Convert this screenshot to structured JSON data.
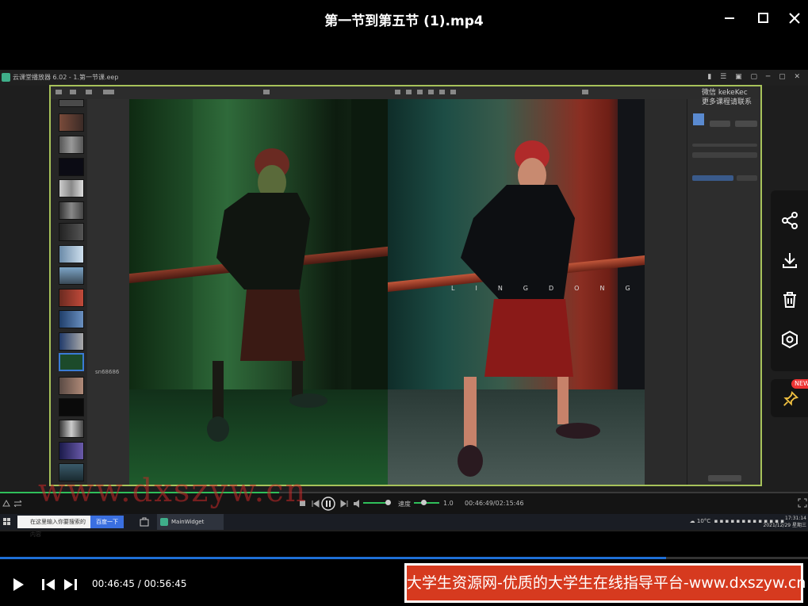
{
  "window": {
    "title": "第一节到第五节 (1).mp4",
    "minimize": "–",
    "close": "✕"
  },
  "recorded_app": {
    "title": "云课堂播放器 6.02 - 1.第一节课.eep",
    "left_code": "sn68686",
    "right_panel": {
      "watermark_line1": "微信 kekeKec",
      "watermark_line2": "更多课程请联系"
    },
    "photo_text": "LINGDONG"
  },
  "recorded_controls": {
    "speed_label": "速度",
    "speed_value": "1.0",
    "time": "00:46:49/02:15:46"
  },
  "recorded_taskbar": {
    "search_placeholder": "在这里输入你要搜索的内容",
    "search_button": "百度一下",
    "app_label": "MainWidget",
    "temperature": "10°C",
    "clock_time": "17:31:14",
    "clock_date": "2021/12/29 星期三"
  },
  "watermark": "www.dxszyw.cn",
  "player": {
    "current_time": "00:46:45",
    "separator": "/",
    "total_time": "00:56:45",
    "progress": 0.824
  },
  "side_panel": {
    "new_badge": "NEW"
  },
  "ad_banner": "大学生资源网-优质的大学生在线指导平台-www.dxszyw.cn",
  "colors": {
    "frame_highlight": "#a7c25a",
    "progress_fill": "#1e6fd6",
    "banner_bg": "#d63a1f",
    "badge": "#e33333"
  }
}
